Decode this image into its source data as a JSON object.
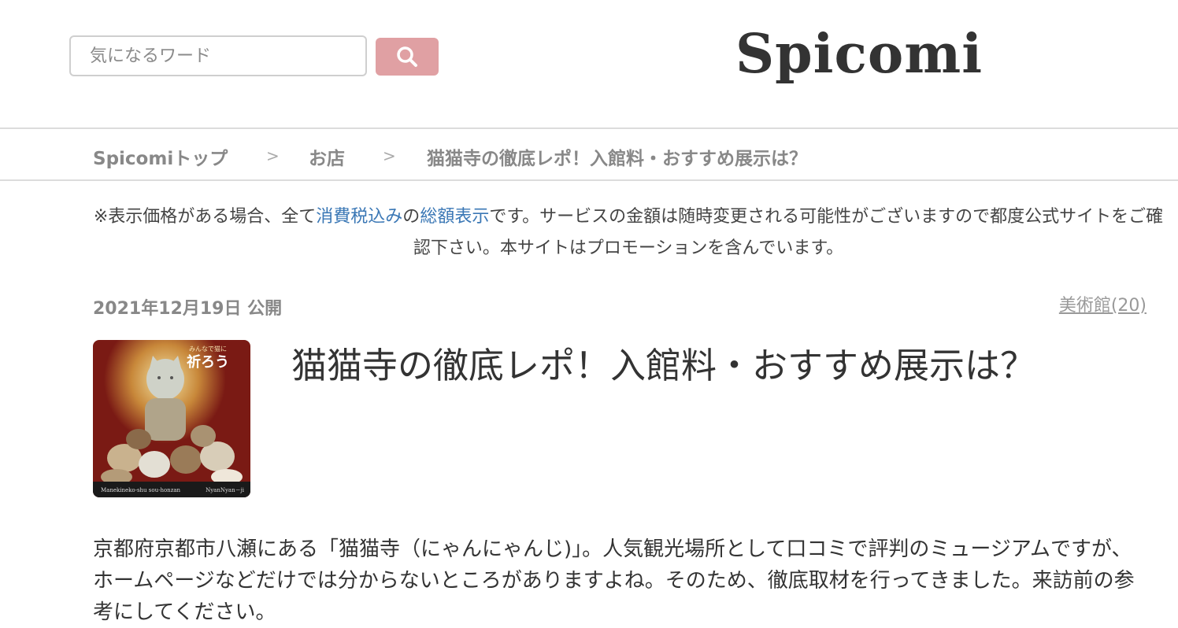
{
  "header": {
    "search_placeholder": "気になるワード",
    "logo": "Spicomi"
  },
  "breadcrumb": {
    "items": [
      "Spicomiトップ",
      "お店",
      "猫猫寺の徹底レポ！入館料・おすすめ展示は？"
    ],
    "separator": ">"
  },
  "notice": {
    "part1": "※表示価格がある場合、全て",
    "link1": "消費税込み",
    "part2": "の",
    "link2": "総額表示",
    "part3": "です。サービスの金額は随時変更される可能性がございますので都度公式サイトをご確認下さい。本サイトはプロモーションを含んでいます。"
  },
  "article": {
    "date": "2021年12月19日 公開",
    "category": "美術館(20)",
    "title": "猫猫寺の徹底レポ！入館料・おすすめ展示は？",
    "thumbnail": {
      "heading": "祈ろう",
      "subheading": "みんなで猫に",
      "caption_left": "Manekineko-shu sou-honzan",
      "caption_right": "NyanNyan－ji"
    },
    "body": "京都府京都市八瀬にある「猫猫寺（にゃんにゃんじ)」。人気観光場所として口コミで評判のミュージアムですが、ホームページなどだけでは分からないところがありますよね。そのため、徹底取材を行ってきました。来訪前の参考にしてください。"
  },
  "colors": {
    "search_button": "#e0a0a3",
    "link": "#3a77b5",
    "thumbnail_bg": "#7a1a14"
  }
}
